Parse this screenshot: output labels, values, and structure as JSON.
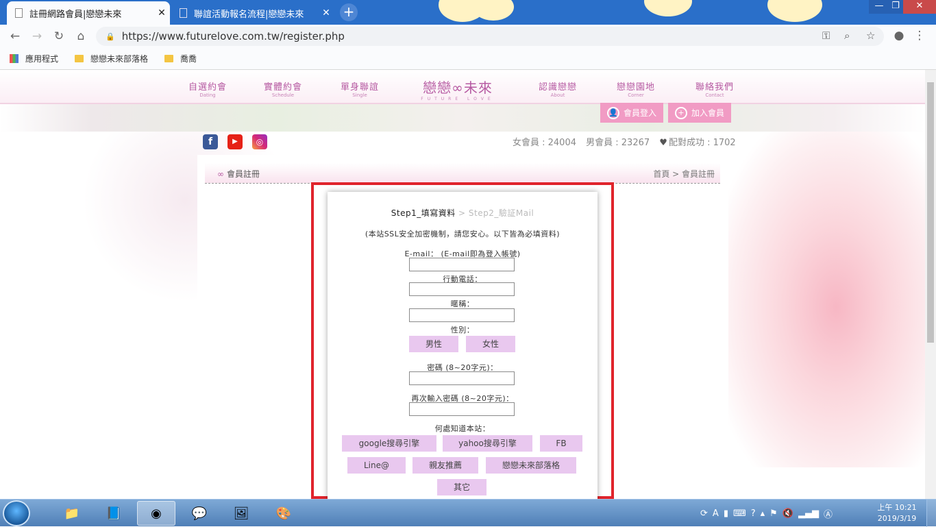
{
  "browser": {
    "tabs": [
      {
        "title": "註冊網路會員|戀戀未來",
        "active": true
      },
      {
        "title": "聯誼活動報名流程|戀戀未來",
        "active": false
      }
    ],
    "new_tab": "+",
    "window_controls": [
      "—",
      "❐",
      "✕"
    ],
    "url": "https://www.futurelove.com.tw/register.php",
    "bookmarks": [
      "應用程式",
      "戀戀未來部落格",
      "喬喬"
    ]
  },
  "site": {
    "nav_left": [
      {
        "zh": "自選約會",
        "en": "Dating"
      },
      {
        "zh": "實體約會",
        "en": "Schedule"
      },
      {
        "zh": "單身聯誼",
        "en": "Single"
      }
    ],
    "logo": {
      "zh": "戀戀∞未來",
      "en": "FUTURE LOVE"
    },
    "nav_right": [
      {
        "zh": "認識戀戀",
        "en": "About"
      },
      {
        "zh": "戀戀園地",
        "en": "Corner"
      },
      {
        "zh": "聯絡我們",
        "en": "Contact"
      }
    ],
    "login_label": "會員登入",
    "join_label": "加入會員",
    "stats": {
      "female": "女會員 : 24004",
      "male": "男會員 : 23267",
      "matched": "配對成功 : 1702"
    },
    "breadcrumb": {
      "title": "會員註冊",
      "path": "首頁 > 會員註冊"
    }
  },
  "form": {
    "step1": "Step1_填寫資料",
    "step_sep": " > ",
    "step2": "Step2_驗証Mail",
    "notice": "(本站SSL安全加密機制，請您安心。以下皆為必填資料)",
    "email_label": "E-mail： (E-mail即為登入帳號)",
    "phone_label": "行動電話：",
    "nickname_label": "暱稱：",
    "gender_label": "性別：",
    "gender_options": [
      "男性",
      "女性"
    ],
    "password_label": "密碼 (8~20字元)：",
    "password2_label": "再次輸入密碼 (8~20字元)：",
    "source_label": "何處知道本站：",
    "source_options": [
      "google搜尋引擎",
      "yahoo搜尋引擎",
      "FB",
      "Line@",
      "親友推薦",
      "戀戀未來部落格",
      "其它"
    ]
  },
  "taskbar": {
    "clock_time": "上午 10:21",
    "clock_date": "2019/3/19"
  }
}
